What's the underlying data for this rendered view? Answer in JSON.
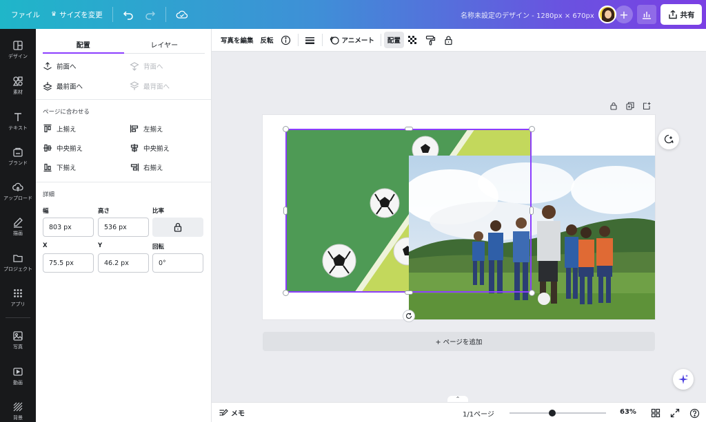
{
  "topbar": {
    "file_label": "ファイル",
    "resize_label": "サイズを変更",
    "title": "名称未設定のデザイン - 1280px × 670px",
    "add_label": "+",
    "share_label": "共有"
  },
  "rail": {
    "items": [
      {
        "label": "デザイン",
        "icon": "layout-icon"
      },
      {
        "label": "素材",
        "icon": "elements-icon"
      },
      {
        "label": "テキスト",
        "icon": "text-icon"
      },
      {
        "label": "ブランド",
        "icon": "brand-icon"
      },
      {
        "label": "アップロード",
        "icon": "upload-icon"
      },
      {
        "label": "描画",
        "icon": "draw-icon"
      },
      {
        "label": "プロジェクト",
        "icon": "folder-icon"
      },
      {
        "label": "アプリ",
        "icon": "apps-icon"
      },
      {
        "label": "写真",
        "icon": "photo-icon"
      },
      {
        "label": "動画",
        "icon": "video-icon"
      },
      {
        "label": "背景",
        "icon": "background-icon"
      }
    ]
  },
  "panel": {
    "tabs": [
      "配置",
      "レイヤー"
    ],
    "order": {
      "forward": "前面へ",
      "backward": "背面へ",
      "to_front": "最前面へ",
      "to_back": "最背面へ"
    },
    "align_heading": "ページに合わせる",
    "align": {
      "top": "上揃え",
      "left": "左揃え",
      "middle": "中央揃え",
      "center": "中央揃え",
      "bottom": "下揃え",
      "right": "右揃え"
    },
    "details_heading": "詳細",
    "fields": {
      "width_label": "幅",
      "width": "803 px",
      "height_label": "高さ",
      "height": "536 px",
      "ratio_label": "比率",
      "x_label": "X",
      "x": "75.5 px",
      "y_label": "Y",
      "y": "46.2 px",
      "rotation_label": "回転",
      "rotation": "0°"
    }
  },
  "toolbar": {
    "edit_photo": "写真を編集",
    "flip": "反転",
    "animate": "アニメート",
    "position": "配置"
  },
  "canvas": {
    "add_page": "+ ページを追加"
  },
  "bottombar": {
    "notes": "メモ",
    "pages": "1/1ページ",
    "zoom": "63%",
    "zoom_level": 0.44
  },
  "colors": {
    "accent": "#8b3dff",
    "rail_bg": "#18191b",
    "field_green": "#4e9a55",
    "lime": "#c3d85c"
  }
}
